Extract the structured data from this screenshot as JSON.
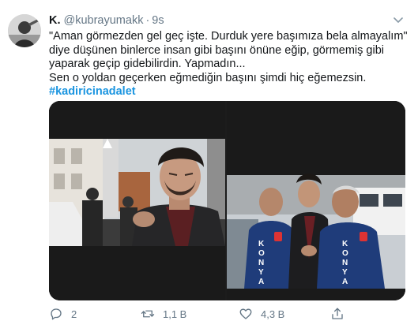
{
  "tweet": {
    "display_name": "K.",
    "handle": "@kubrayumakk",
    "separator": "·",
    "time": "9s",
    "lines": [
      "\"Aman görmezden gel geç işte. Durduk yere başımıza bela almayalım\"",
      "diye düşünen binlerce insan gibi başını önüne eğip, görmemiş gibi",
      "yaparak geçip gidebilirdin. Yapmadın...",
      "Sen o yoldan geçerken eğmediğin başını şimdi hiç eğemezsin."
    ],
    "hashtag": "#kadiricinadalet",
    "media": {
      "left_photo_icon": "photo-street-man-looking-down",
      "right_photo_icon": "photo-man-escorted-by-officers",
      "vest_text": [
        "K",
        "O",
        "N",
        "Y",
        "A"
      ]
    },
    "actions": {
      "reply_count": "2",
      "retweet_count": "1,1 B",
      "like_count": "4,3 B"
    }
  },
  "colors": {
    "link": "#1b95e0",
    "secondary_text": "#657786",
    "primary_text": "#14171a",
    "vest_blue": "#1f3c7a"
  }
}
